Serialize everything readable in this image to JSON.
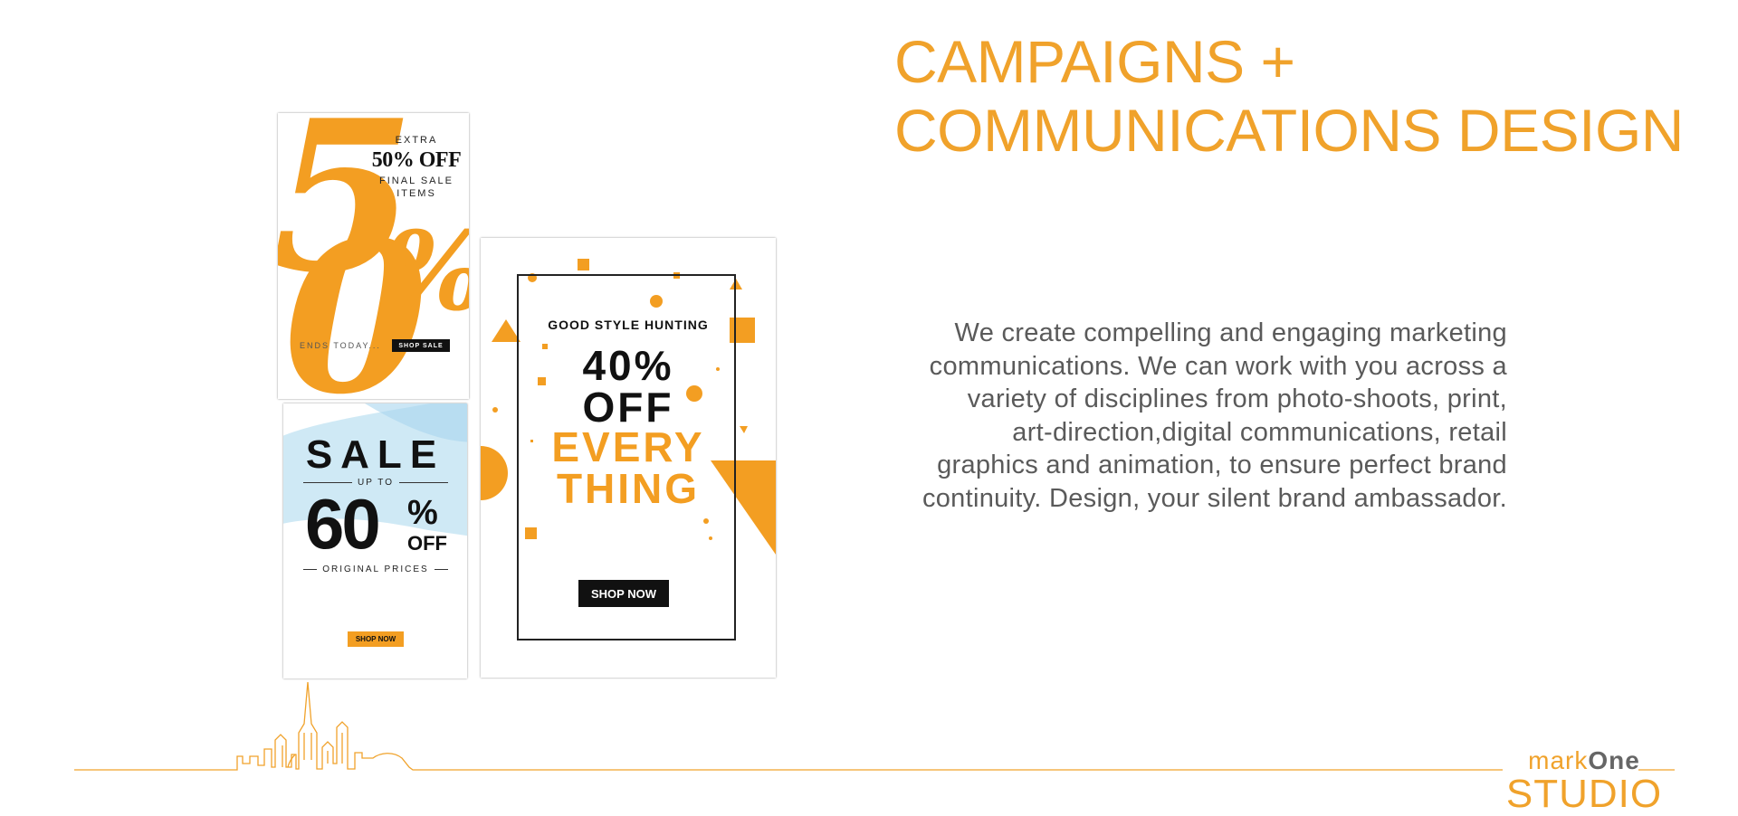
{
  "heading": {
    "line1": "CAMPAIGNS +",
    "line2": "COMMUNICATIONS DESIGN"
  },
  "body_lines": [
    "We create compelling and engaging marketing",
    "communications. We can work with you across a",
    "variety of disciplines from photo-shoots, print,",
    "art-direction,digital communications, retail",
    "graphics and animation, to ensure perfect brand",
    "continuity. Design, your silent brand ambassador."
  ],
  "poster1": {
    "big_number_5": "5",
    "big_number_0": "0",
    "big_percent": "%",
    "extra": "EXTRA",
    "offer": "50% OFF",
    "final_line1": "FINAL SALE",
    "final_line2": "ITEMS",
    "ends": "ENDS TODAY...",
    "button": "SHOP SALE"
  },
  "poster2": {
    "sale": "SALE",
    "up_to": "UP TO",
    "number": "60",
    "percent": "%",
    "off": "OFF",
    "original": "ORIGINAL PRICES",
    "button": "SHOP NOW"
  },
  "poster3": {
    "headline": "GOOD STYLE HUNTING",
    "percent_line": "40%",
    "off_line": "OFF",
    "every": "EVERY",
    "thing": "THING",
    "button": "SHOP NOW"
  },
  "logo": {
    "mark": "mark",
    "one": "One",
    "studio": "STUDIO"
  },
  "colors": {
    "accent": "#f0a22b",
    "body_text": "#5a5a5a",
    "dark": "#111111"
  }
}
